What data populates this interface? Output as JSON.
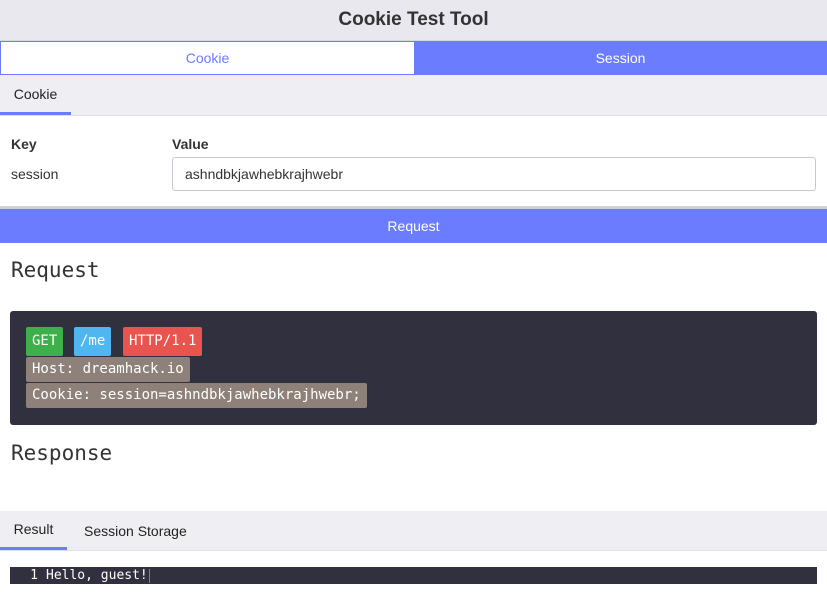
{
  "app": {
    "title": "Cookie Test Tool"
  },
  "main_tabs": [
    {
      "label": "Cookie",
      "active": false
    },
    {
      "label": "Session",
      "active": true
    }
  ],
  "sub_tab": {
    "label": "Cookie"
  },
  "kv": {
    "key_header": "Key",
    "value_header": "Value",
    "key": "session",
    "value": "ashndbkjawhebkrajhwebr"
  },
  "request_button": "Request",
  "request_section": {
    "title": "Request",
    "method": "GET",
    "path": "/me",
    "protocol": "HTTP/1.1",
    "headers": [
      "Host: dreamhack.io",
      "Cookie: session=ashndbkjawhebkrajhwebr;"
    ]
  },
  "response_section": {
    "title": "Response",
    "tabs": [
      {
        "label": "Result",
        "active": true
      },
      {
        "label": "Session Storage",
        "active": false
      }
    ],
    "output": {
      "line_number": "1",
      "text": "Hello, guest!"
    }
  },
  "colors": {
    "accent": "#6b7cff",
    "method": "#3db04b",
    "path": "#4fb6ef",
    "protocol": "#e9544f",
    "header_chip": "#8e8179",
    "code_bg": "#30303f"
  }
}
